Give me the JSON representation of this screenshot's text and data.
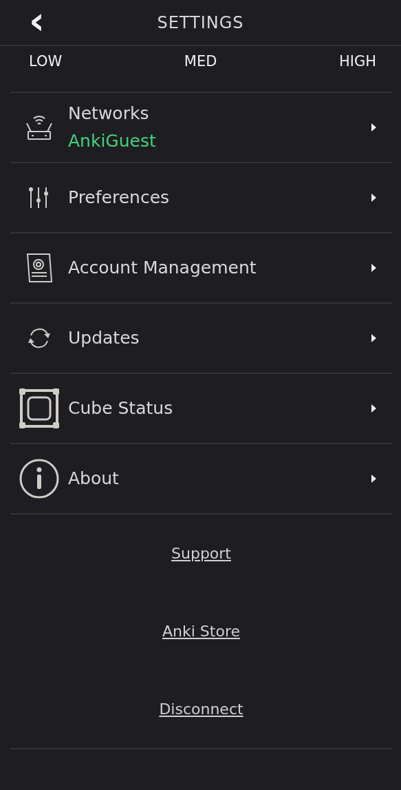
{
  "header": {
    "back": "‹",
    "title": "SETTINGS"
  },
  "quality_labels": [
    "LOW",
    "MED",
    "HIGH"
  ],
  "items": [
    {
      "kind": "router",
      "label": "Networks",
      "subtitle": "AnkiGuest"
    },
    {
      "kind": "sliders",
      "label": "Preferences"
    },
    {
      "kind": "account",
      "label": "Account Management"
    },
    {
      "kind": "sync",
      "label": "Updates"
    },
    {
      "kind": "cube",
      "label": "Cube Status"
    },
    {
      "kind": "info",
      "label": "About"
    }
  ],
  "links": [
    "Support",
    "Anki Store",
    "Disconnect"
  ]
}
